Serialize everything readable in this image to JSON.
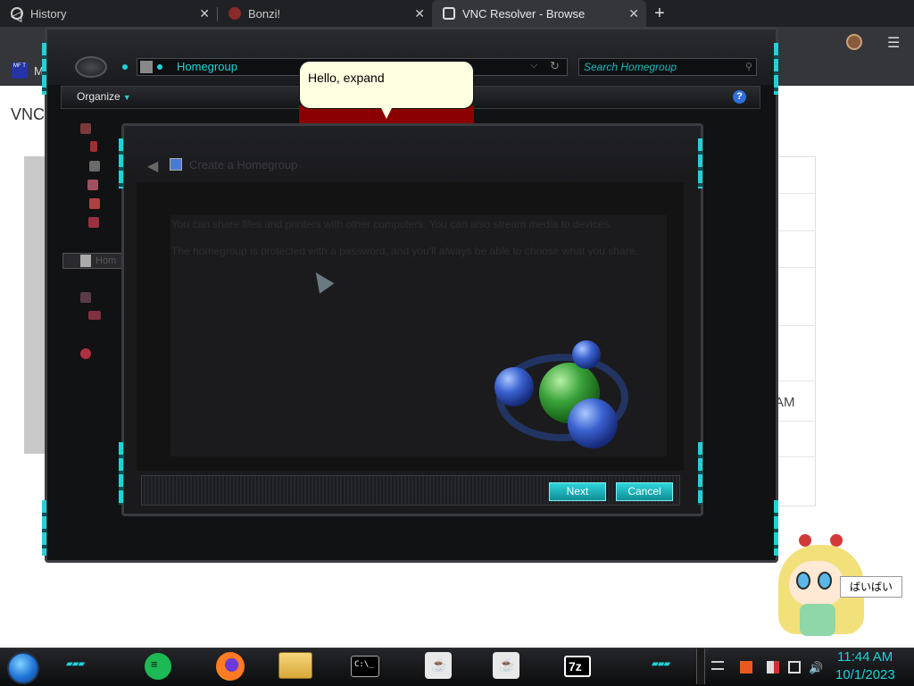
{
  "browser": {
    "tabs": [
      {
        "title": "History",
        "active": false
      },
      {
        "title": "Bonzi!",
        "active": false
      },
      {
        "title": "VNC Resolver - Browse",
        "active": true
      }
    ],
    "new_tab_label": "+",
    "bookmark_label": "M",
    "bookmark_icon_text": "MF T"
  },
  "background_page": {
    "heading": "VNC",
    "cell_text": "AM"
  },
  "explorer": {
    "address": "Homegroup",
    "search_placeholder": "Search Homegroup",
    "toolbar": {
      "organize_label": "Organize",
      "help_label": "?"
    },
    "nav_selected_label": "Hom"
  },
  "tooltip": {
    "text": "Hello, expand"
  },
  "dialog": {
    "title": "Create a Homegroup",
    "line1": "You can share files and printers with other computers. You can also stream media to devices.",
    "line2": "The homegroup is protected with a password, and you'll always be able to choose what you share.",
    "next_label": "Next",
    "cancel_label": "Cancel"
  },
  "taskbar": {
    "apps": [
      {
        "name": "spotify-icon"
      },
      {
        "name": "firefox-icon"
      },
      {
        "name": "file-explorer-icon"
      },
      {
        "name": "command-prompt-icon",
        "glyph": "C:\\_"
      },
      {
        "name": "java-icon"
      },
      {
        "name": "java-icon"
      },
      {
        "name": "7zip-icon",
        "glyph": "7z"
      }
    ],
    "time": "11:44 AM",
    "date": "10/1/2023"
  },
  "mascot": {
    "speech": "ばいばい"
  },
  "colors": {
    "accent": "#1fd3d8",
    "tooltip_bg": "#ffffe1",
    "balloon_band": "#8b0000"
  }
}
